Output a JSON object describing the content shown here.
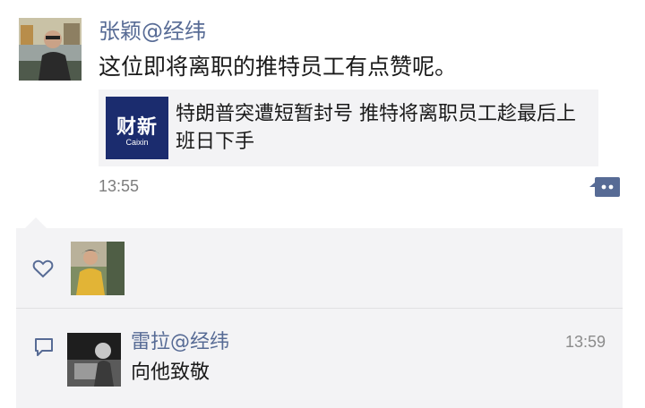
{
  "post": {
    "author": "张颖@经纬",
    "text": "这位即将离职的推特员工有点赞呢。",
    "time": "13:55",
    "link": {
      "thumb_main": "财新",
      "thumb_sub": "Caixin",
      "title": "特朗普突遭短暂封号 推特将离职员工趁最后上班日下手"
    }
  },
  "comment": {
    "author": "雷拉@经纬",
    "time": "13:59",
    "text": "向他致敬"
  },
  "colors": {
    "name_link": "#576b95",
    "panel_bg": "#f3f3f5"
  },
  "icons": {
    "like": "heart-outline-icon",
    "comment": "speech-bubble-icon",
    "more": "more-dots-icon"
  }
}
